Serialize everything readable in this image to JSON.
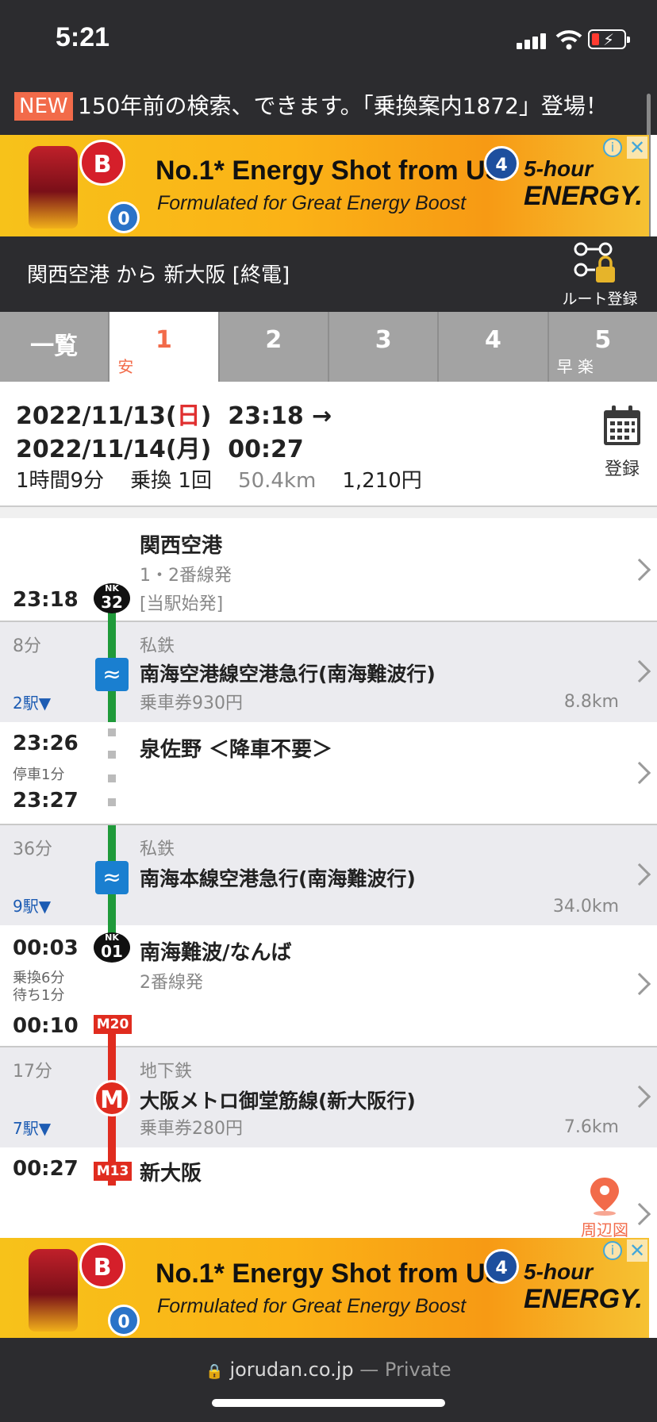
{
  "status_bar": {
    "time": "5:21"
  },
  "news": {
    "badge": "NEW",
    "text": "150年前の検索、できます。「乗換案内1872」登場！"
  },
  "ad": {
    "logo_b": "B",
    "logo_zero": "0",
    "logo_four": "4",
    "headline": "No.1* Energy Shot from US",
    "subline": "Formulated for Great Energy Boost",
    "brand_top": "5-hour",
    "brand_bottom": "ENERGY.",
    "info_icon": "info-icon",
    "close_icon": "close-icon"
  },
  "route": {
    "title": "関西空港 から 新大阪 [終電]",
    "register_label": "ルート登録"
  },
  "tabs": [
    {
      "label": "一覧",
      "tag": ""
    },
    {
      "label": "1",
      "tag": "安"
    },
    {
      "label": "2",
      "tag": ""
    },
    {
      "label": "3",
      "tag": ""
    },
    {
      "label": "4",
      "tag": ""
    },
    {
      "label": "5",
      "tag": "早 楽"
    }
  ],
  "summary": {
    "dep_date": "2022/11/13(",
    "dep_day": "日",
    "dep_close": ")",
    "dep_time": "23:18 →",
    "arr_date": "2022/11/14(月)",
    "arr_time": "00:27",
    "duration": "1時間9分",
    "transfers": "乗換 1回",
    "distance": "50.4km",
    "fare": "1,210円",
    "calendar_label": "登録"
  },
  "timeline": {
    "s1": {
      "time": "23:18",
      "name": "関西空港",
      "platform": "1・2番線発",
      "note": "[当駅始発]",
      "code_top": "NK",
      "code_bot": "32"
    },
    "l1": {
      "duration": "8分",
      "stops": "2駅▼",
      "type": "私鉄",
      "name": "南海空港線空港急行(南海難波行)",
      "fare": "乗車券930円",
      "km": "8.8km"
    },
    "s2": {
      "arr": "23:26",
      "stop_note": "停車1分",
      "dep": "23:27",
      "name": "泉佐野 ＜降車不要＞"
    },
    "l2": {
      "duration": "36分",
      "stops": "9駅▼",
      "type": "私鉄",
      "name": "南海本線空港急行(南海難波行)",
      "km": "34.0km"
    },
    "s3": {
      "arr": "00:03",
      "transfer": "乗換6分",
      "wait": "待ち1分",
      "dep": "00:10",
      "name": "南海難波/なんば",
      "platform": "2番線発",
      "code_top": "NK",
      "code_bot": "01",
      "code_m": "M20"
    },
    "l3": {
      "duration": "17分",
      "stops": "7駅▼",
      "type": "地下鉄",
      "name": "大阪メトロ御堂筋線(新大阪行)",
      "fare": "乗車券280円",
      "km": "7.6km",
      "badge": "M"
    },
    "s4": {
      "time": "00:27",
      "name": "新大阪",
      "code_m": "M13",
      "map_label": "周辺図"
    }
  },
  "browser": {
    "url": "jorudan.co.jp",
    "private": "— Private"
  },
  "colors": {
    "accent": "#f26b4a",
    "dark": "#2c2c2f",
    "green_line": "#1f9a3a",
    "red_line": "#e02c1f",
    "nankai_blue": "#1a7fd0"
  }
}
